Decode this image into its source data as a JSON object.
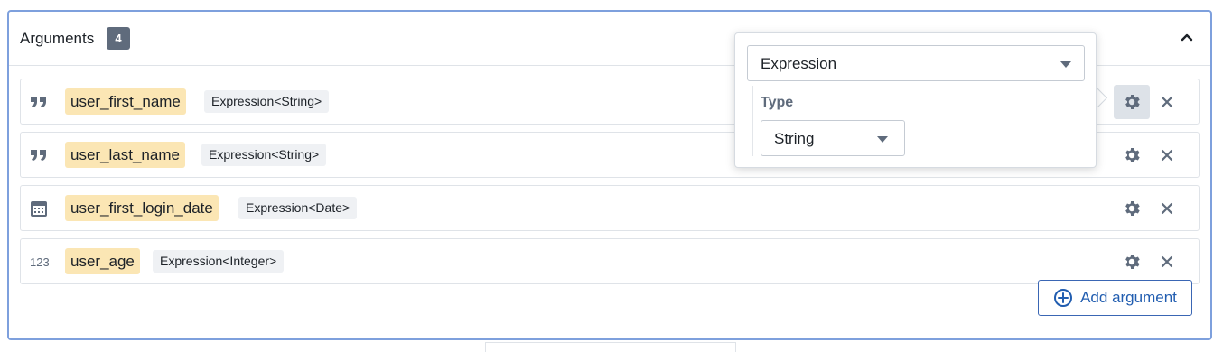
{
  "header": {
    "title": "Arguments",
    "count": "4"
  },
  "arguments": [
    {
      "icon": "quote-icon",
      "name": "user_first_name",
      "type": "Expression<String>"
    },
    {
      "icon": "quote-icon",
      "name": "user_last_name",
      "type": "Expression<String>"
    },
    {
      "icon": "calendar-icon",
      "name": "user_first_login_date",
      "type": "Expression<Date>"
    },
    {
      "icon": "number-icon",
      "icon_text": "123",
      "name": "user_age",
      "type": "Expression<Integer>"
    }
  ],
  "add_button": {
    "label": "Add argument"
  },
  "popover": {
    "mode_value": "Expression",
    "type_label": "Type",
    "type_value": "String"
  },
  "colors": {
    "accent": "#215db0",
    "name_highlight": "#fbe6b4",
    "badge": "#5f6b7c"
  }
}
